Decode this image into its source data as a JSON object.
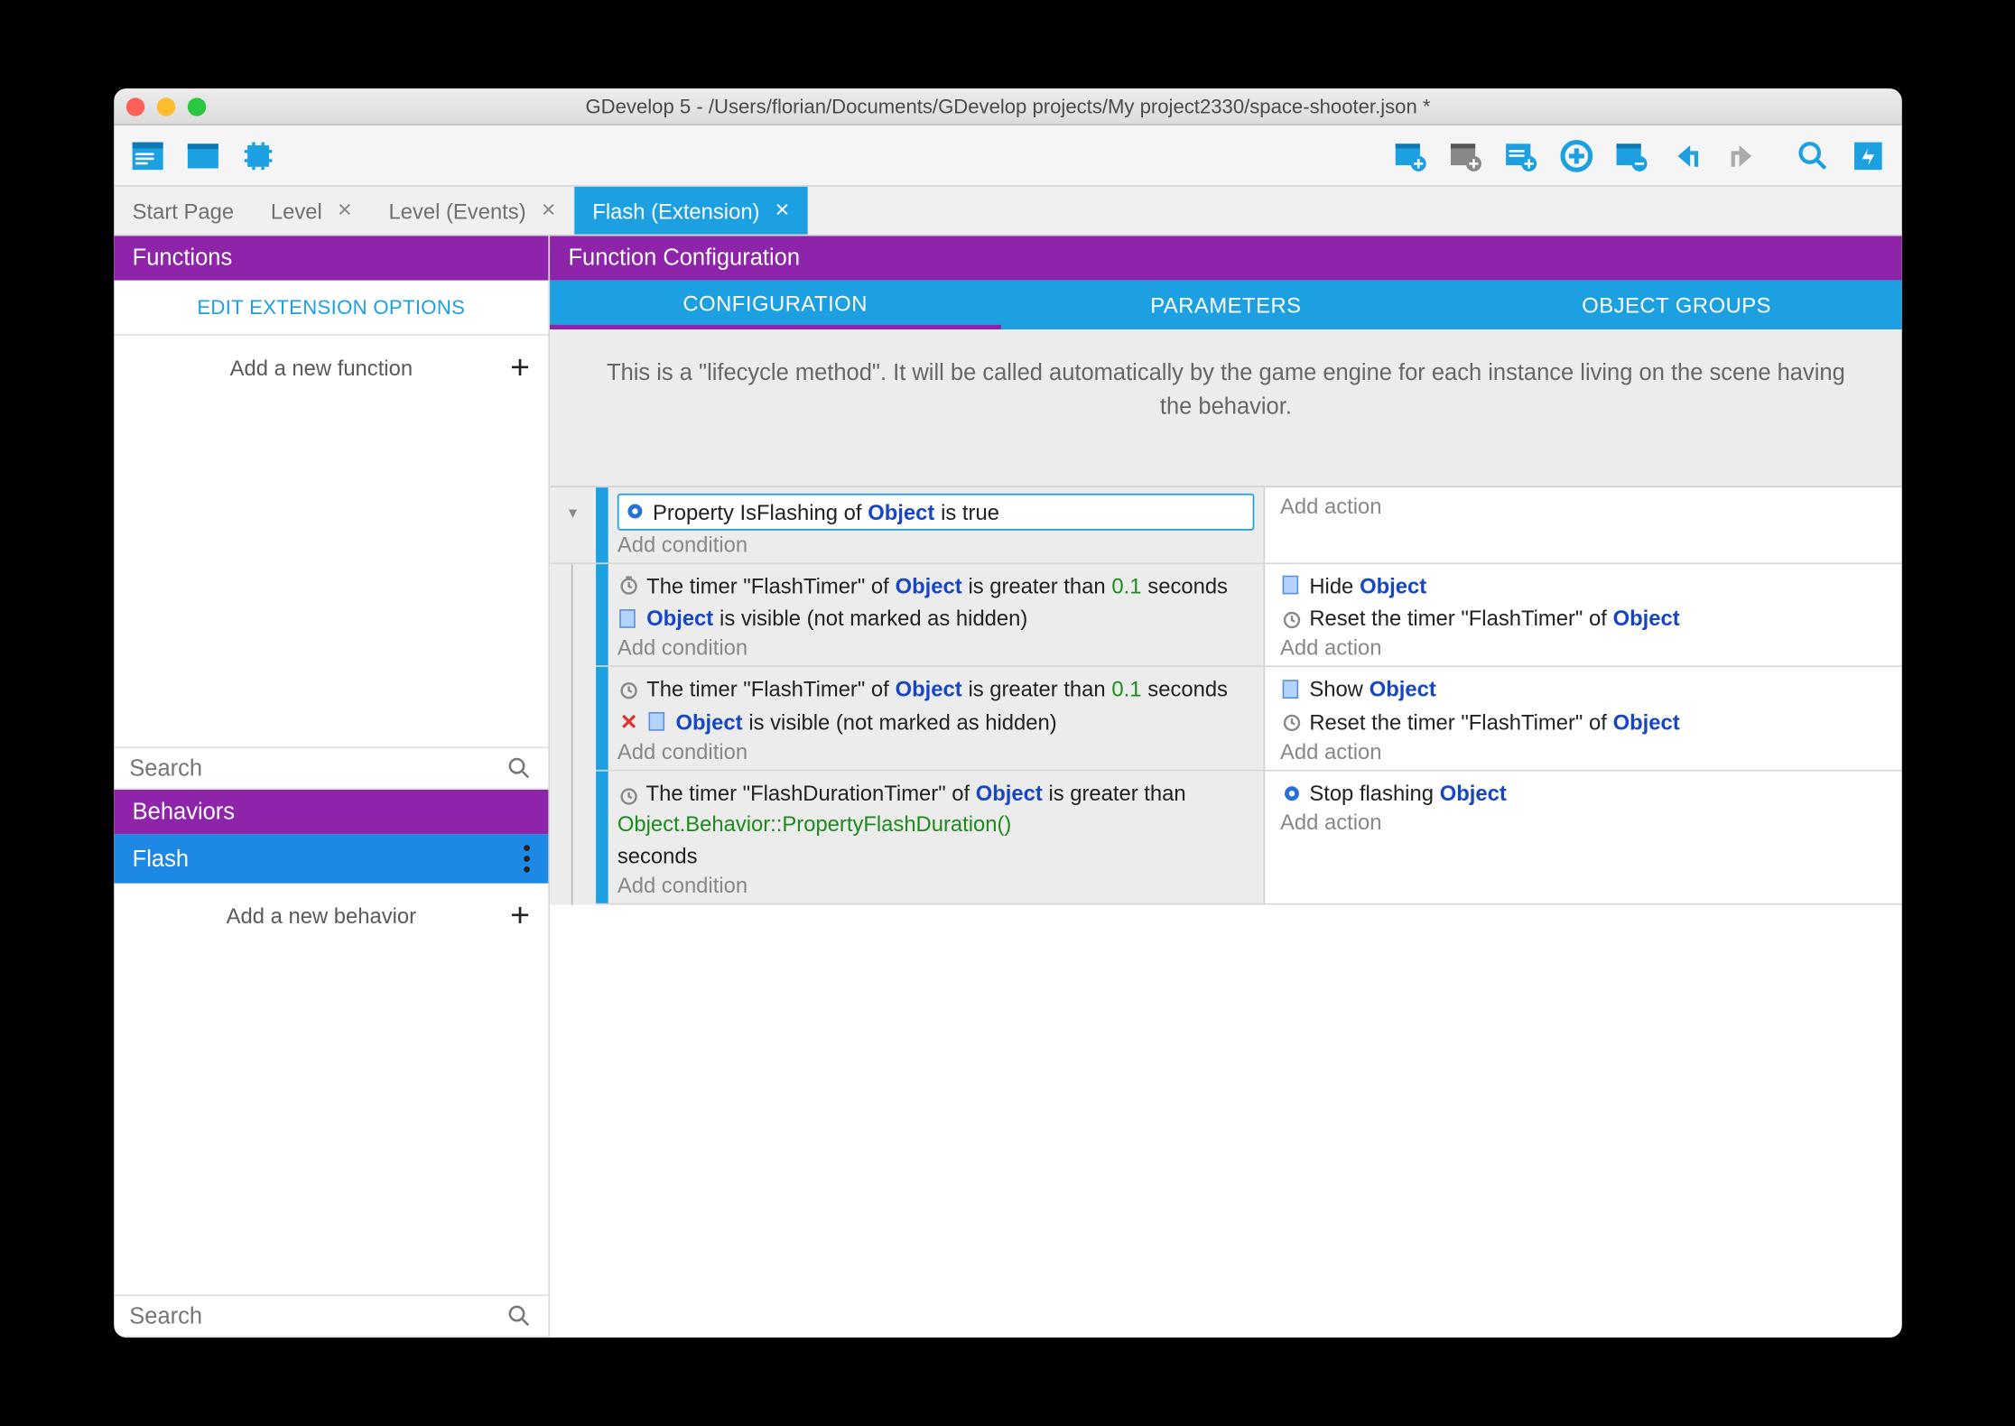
{
  "window": {
    "title": "GDevelop 5 - /Users/florian/Documents/GDevelop projects/My project2330/space-shooter.json *"
  },
  "tabs": [
    {
      "label": "Start Page",
      "closable": false
    },
    {
      "label": "Level",
      "closable": true
    },
    {
      "label": "Level (Events)",
      "closable": true
    },
    {
      "label": "Flash (Extension)",
      "closable": true,
      "active": true
    }
  ],
  "sidebar": {
    "functions_header": "Functions",
    "edit_extension": "EDIT EXTENSION OPTIONS",
    "add_function": "Add a new function",
    "search_placeholder": "Search",
    "behaviors_header": "Behaviors",
    "behavior_item": "Flash",
    "add_behavior": "Add a new behavior",
    "search2_placeholder": "Search"
  },
  "main": {
    "config_header": "Function Configuration",
    "subtabs": {
      "configuration": "CONFIGURATION",
      "parameters": "PARAMETERS",
      "object_groups": "OBJECT GROUPS"
    },
    "lifecycle_text": "This is a \"lifecycle method\". It will be called automatically by the game engine for each instance living on the scene having the behavior.",
    "add_condition": "Add condition",
    "add_action": "Add action",
    "event1": {
      "cond1_pre": "Property IsFlashing of",
      "cond1_obj": "Object",
      "cond1_post": "is true"
    },
    "event2": {
      "cond1_pre": "The timer \"FlashTimer\" of",
      "cond1_obj": "Object",
      "cond1_mid": "is greater than",
      "cond1_num": "0.1",
      "cond1_post": "seconds",
      "cond2_obj": "Object",
      "cond2_post": "is visible (not marked as hidden)",
      "act1_pre": "Hide",
      "act1_obj": "Object",
      "act2_pre": "Reset the timer \"FlashTimer\" of",
      "act2_obj": "Object"
    },
    "event3": {
      "cond1_pre": "The timer \"FlashTimer\" of",
      "cond1_obj": "Object",
      "cond1_mid": "is greater than",
      "cond1_num": "0.1",
      "cond1_post": "seconds",
      "cond2_obj": "Object",
      "cond2_post": "is visible (not marked as hidden)",
      "act1_pre": "Show",
      "act1_obj": "Object",
      "act2_pre": "Reset the timer \"FlashTimer\" of",
      "act2_obj": "Object"
    },
    "event4": {
      "cond1_pre": "The timer \"FlashDurationTimer\" of",
      "cond1_obj": "Object",
      "cond1_mid": "is greater than",
      "cond1_expr": "Object.Behavior::PropertyFlashDuration()",
      "cond1_post": "seconds",
      "act1_pre": "Stop flashing",
      "act1_obj": "Object"
    }
  }
}
